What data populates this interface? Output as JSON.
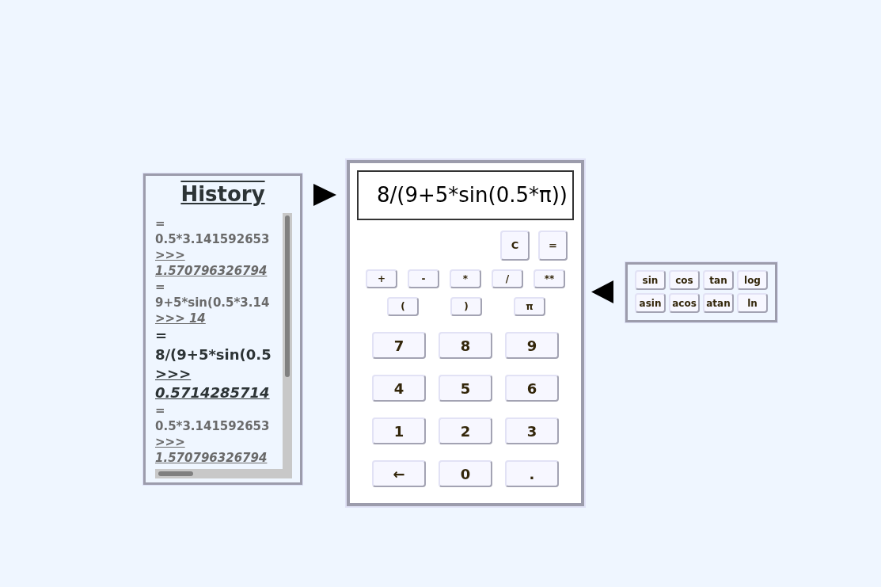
{
  "history": {
    "title": "History",
    "entries": [
      {
        "input": "= 0.5*3.141592653",
        "output": ">>> 1.570796326794",
        "selected": false
      },
      {
        "input": "= 9+5*sin(0.5*3.14",
        "output": ">>> 14",
        "selected": false
      },
      {
        "input": "= 8/(9+5*sin(0.5",
        "output": ">>> 0.5714285714",
        "selected": true
      },
      {
        "input": "= 0.5*3.141592653",
        "output": ">>> 1.570796326794",
        "selected": false
      }
    ]
  },
  "calculator": {
    "display": "8/(9+5*sin(0.5*π))",
    "control_keys": [
      "C",
      "="
    ],
    "operator_keys": [
      "+",
      "-",
      "*",
      "/",
      "**"
    ],
    "grouping_keys": [
      "(",
      ")",
      "π"
    ],
    "number_keys": [
      "7",
      "8",
      "9",
      "4",
      "5",
      "6",
      "1",
      "2",
      "3",
      "←",
      "0",
      "."
    ]
  },
  "functions": {
    "keys": [
      "sin",
      "cos",
      "tan",
      "log",
      "asin",
      "acos",
      "atan",
      "ln"
    ]
  }
}
